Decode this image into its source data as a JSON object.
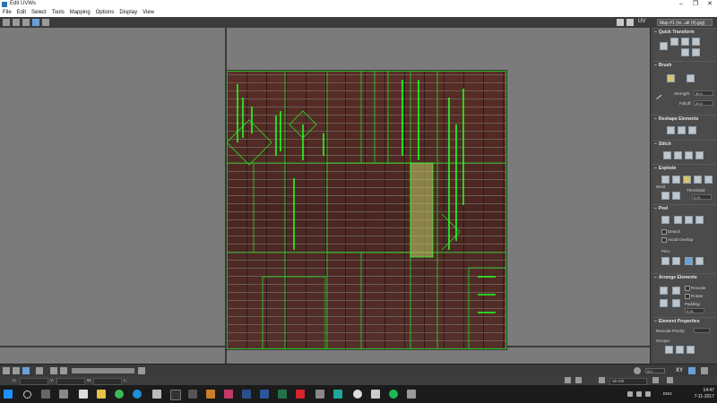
{
  "window": {
    "title": "Edit UVWs",
    "minimize": "–",
    "maximize": "❐",
    "close": "✕"
  },
  "menu": [
    "File",
    "Edit",
    "Select",
    "Tools",
    "Mapping",
    "Options",
    "Display",
    "View"
  ],
  "toolbar": {
    "uv_label": "UV",
    "map_select": "Map #1 (re...all (4).jpg)"
  },
  "panel": {
    "quick_transform": "Quick Transform",
    "brush": "Brush",
    "strength_label": "Strength:",
    "strength_value": "30,0",
    "falloff_label": "Falloff:",
    "falloff_value": "20,0",
    "reshape": "Reshape Elements",
    "stitch": "Stitch",
    "explode": "Explode",
    "weld_label": "Weld",
    "threshold_label": "Threshold:",
    "threshold_value": "0,01",
    "peel": "Peel",
    "detach_label": "Detach",
    "avoid_overlap_label": "Avoid Overlap",
    "pins_label": "Pins:",
    "arrange": "Arrange Elements",
    "rescale_label": "Rescale",
    "rotate_label": "Rotate",
    "padding_label": "Padding:",
    "padding_value": "0,01",
    "element_props": "Element Properties",
    "rescale_priority_label": "Rescale Priority:",
    "groups_label": "Groups:"
  },
  "bottom": {
    "zoom_value": "0,0",
    "xy_label": "XY"
  },
  "status": {
    "u_label": "U:",
    "v_label": "V:",
    "w_label": "W:",
    "l_label": "L:",
    "grid_value": "16 Grit"
  },
  "tray": {
    "lang": "ENG",
    "time": "14:47",
    "date": "7-11-2017"
  },
  "colors": {
    "uv_edge": "#22dd22",
    "selected_face": "#b8c060",
    "viewport_bg": "#7b7b7b"
  }
}
